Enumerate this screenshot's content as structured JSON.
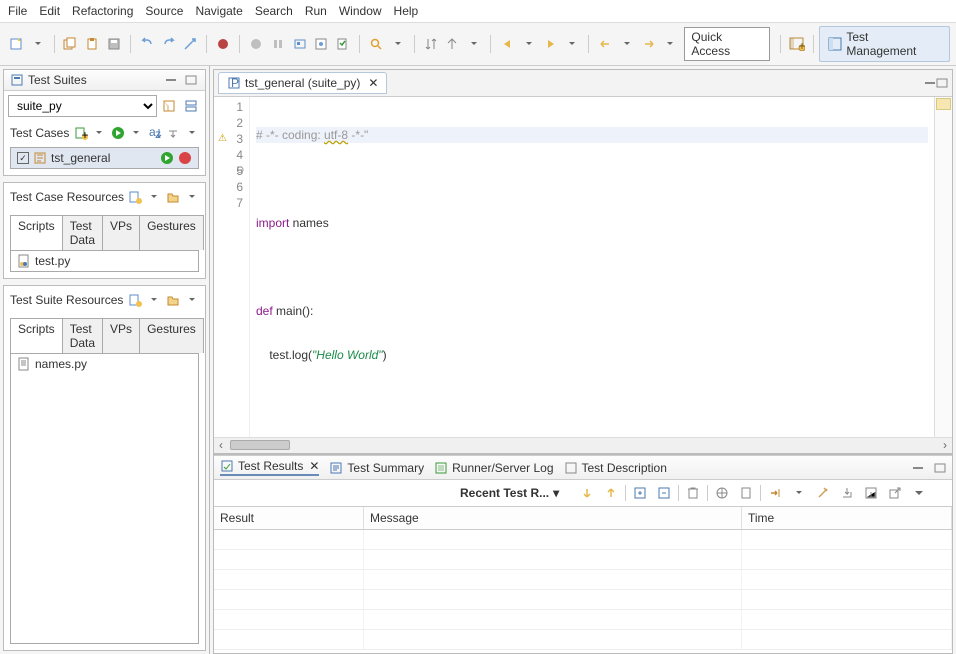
{
  "menu": [
    "File",
    "Edit",
    "Refactoring",
    "Source",
    "Navigate",
    "Search",
    "Run",
    "Window",
    "Help"
  ],
  "quick_access": "Quick Access",
  "perspective": "Test Management",
  "left": {
    "test_suites": {
      "title": "Test Suites",
      "selected_suite": "suite_py",
      "test_cases_label": "Test Cases",
      "cases": [
        {
          "name": "tst_general",
          "checked": true,
          "selected": true
        }
      ],
      "test_case_resources_label": "Test Case Resources",
      "resource_tabs": [
        "Scripts",
        "Test Data",
        "VPs",
        "Gestures"
      ],
      "resource_tab_active": 0,
      "case_resources": [
        "test.py"
      ],
      "test_suite_resources_label": "Test Suite Resources",
      "suite_resources": [
        "names.py"
      ]
    }
  },
  "editor": {
    "tab_label": "tst_general (suite_py)",
    "lines": [
      {
        "n": 1,
        "type": "comment",
        "text": "# -*- coding: utf-8 -*-\"",
        "wavy": "utf-8",
        "highlight": true
      },
      {
        "n": 2,
        "type": "blank",
        "text": ""
      },
      {
        "n": 3,
        "type": "import",
        "kw": "import",
        "rest": " names",
        "warn": true
      },
      {
        "n": 4,
        "type": "blank",
        "text": ""
      },
      {
        "n": 5,
        "type": "def",
        "kw": "def",
        "rest": " main():",
        "fold": true
      },
      {
        "n": 6,
        "type": "call",
        "indent": "    test.log(",
        "str": "\"Hello World\"",
        "tail": ")"
      },
      {
        "n": 7,
        "type": "blank",
        "text": ""
      }
    ]
  },
  "bottom": {
    "tabs": [
      "Test Results",
      "Test Summary",
      "Runner/Server Log",
      "Test Description"
    ],
    "active_tab": 0,
    "recent_label": "Recent Test R...",
    "columns": [
      "Result",
      "Message",
      "Time"
    ]
  }
}
